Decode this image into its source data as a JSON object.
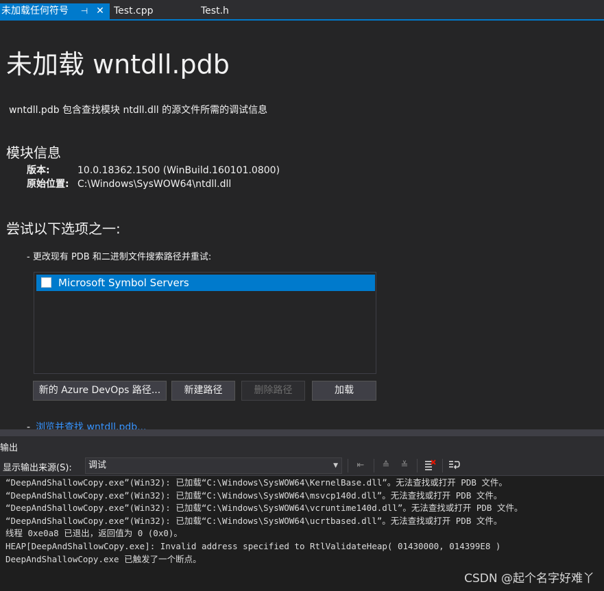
{
  "tabs": [
    {
      "label": "未加载任何符号",
      "pin": "⊣",
      "close": "✕"
    },
    {
      "label": "Test.cpp"
    },
    {
      "label": "Test.h"
    }
  ],
  "doc": {
    "title": "未加载 wntdll.pdb",
    "description": "wntdll.pdb 包含查找模块 ntdll.dll 的源文件所需的调试信息",
    "module_heading": "模块信息",
    "version_key": "版本:",
    "version_val": "10.0.18362.1500 (WinBuild.160101.0800)",
    "location_key": "原始位置:",
    "location_val": "C:\\Windows\\SysWOW64\\ntdll.dll",
    "options_heading": "尝试以下选项之一:",
    "bullet": "-  更改现有 PDB 和二进制文件搜索路径并重试:",
    "list_items": [
      "Microsoft Symbol Servers"
    ],
    "buttons": {
      "azure": "新的 Azure DevOps 路径...",
      "new_path": "新建路径",
      "delete_path": "删除路径",
      "load": "加载"
    },
    "browse_dash": "-",
    "browse_link": "浏览并查找 wntdll.pdb..."
  },
  "output_panel": {
    "title": "输出",
    "source_label": "显示输出来源(S):",
    "source_value": "调试",
    "lines": [
      "“DeepAndShallowCopy.exe”(Win32): 已加载“C:\\Windows\\SysWOW64\\KernelBase.dll”。无法查找或打开 PDB 文件。",
      "“DeepAndShallowCopy.exe”(Win32): 已加载“C:\\Windows\\SysWOW64\\msvcp140d.dll”。无法查找或打开 PDB 文件。",
      "“DeepAndShallowCopy.exe”(Win32): 已加载“C:\\Windows\\SysWOW64\\vcruntime140d.dll”。无法查找或打开 PDB 文件。",
      "“DeepAndShallowCopy.exe”(Win32): 已加载“C:\\Windows\\SysWOW64\\ucrtbased.dll”。无法查找或打开 PDB 文件。",
      "线程 0xe0a8 已退出，返回值为 0 (0x0)。",
      "HEAP[DeepAndShallowCopy.exe]: Invalid address specified to RtlValidateHeap( 01430000, 014399E8 )",
      "DeepAndShallowCopy.exe 已触发了一个断点。"
    ]
  },
  "watermark": "CSDN @起个名字好难丫",
  "colors": {
    "accent": "#007acc",
    "link": "#3794ff",
    "background": "#1e1e1e"
  }
}
